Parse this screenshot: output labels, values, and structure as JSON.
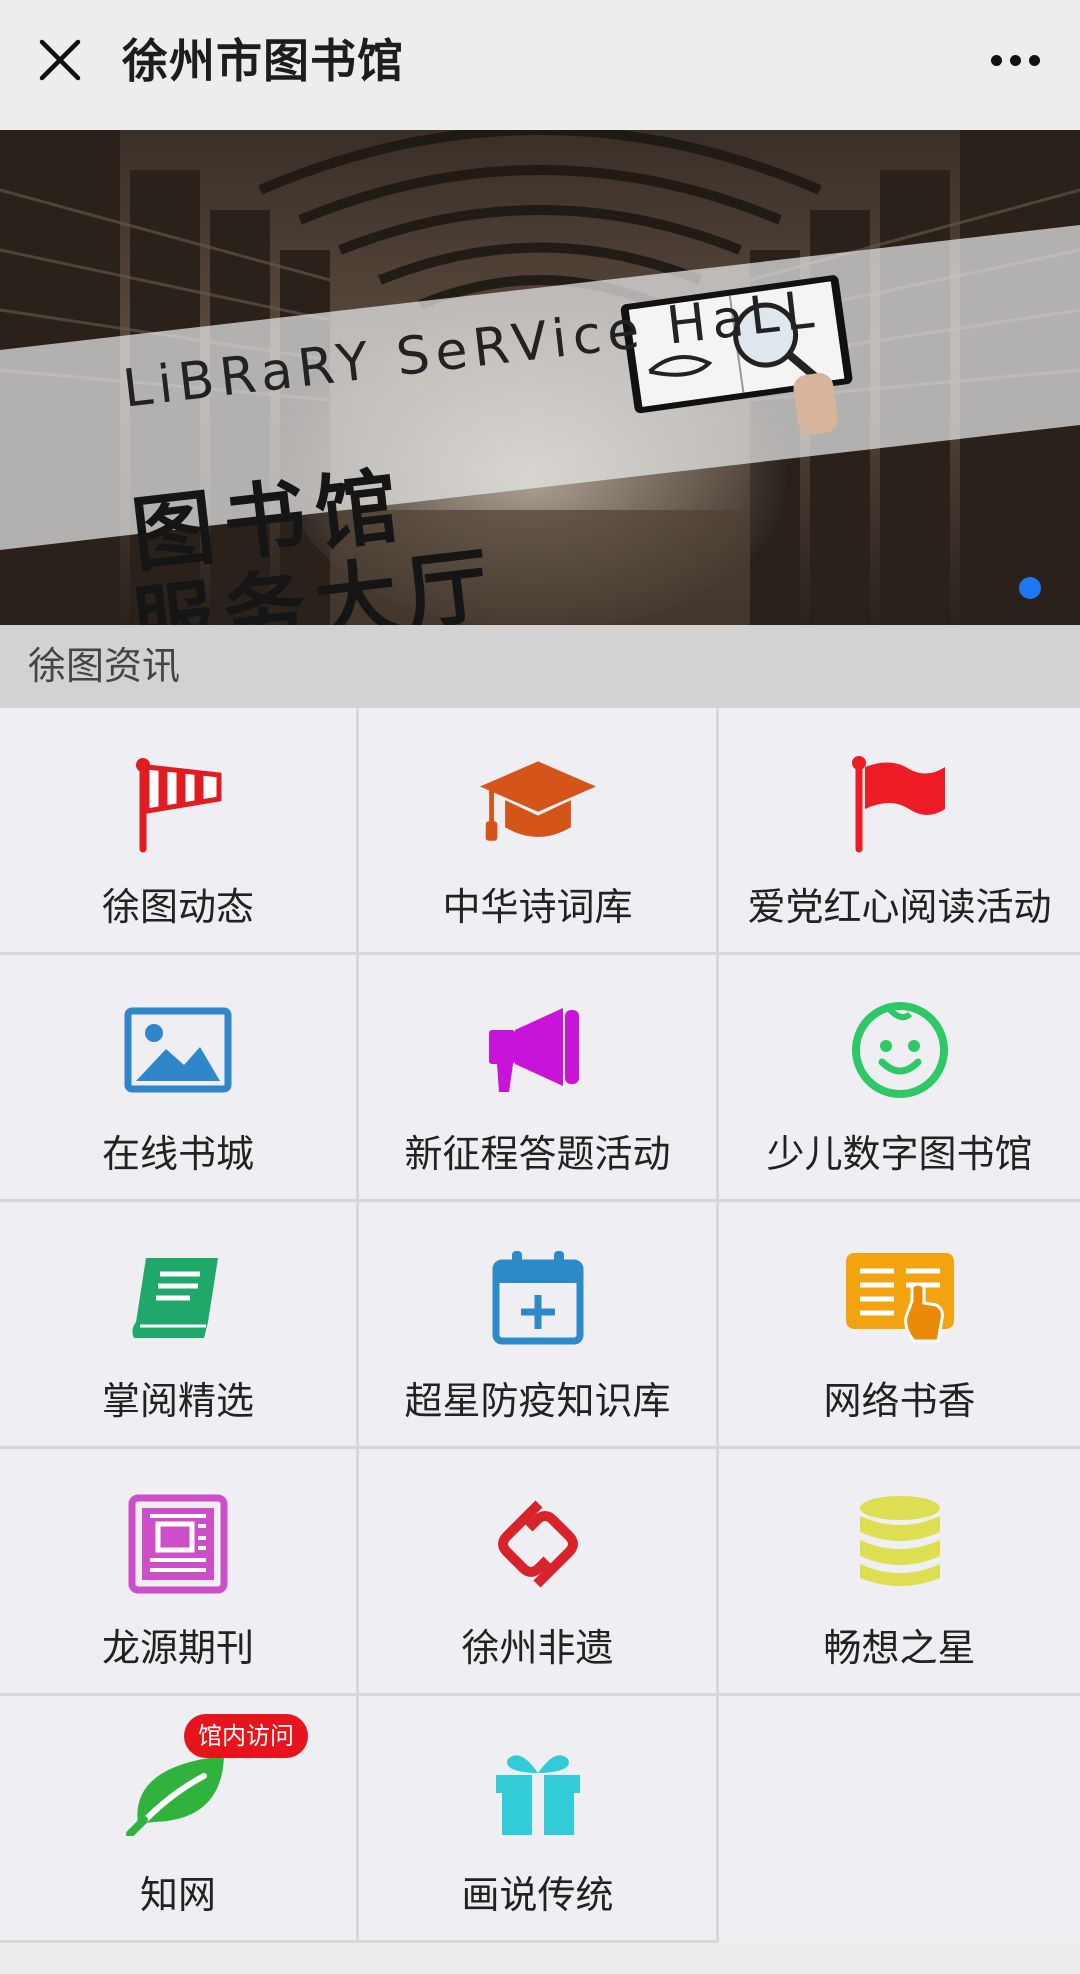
{
  "window": {
    "title": "徐州市图书馆",
    "close_icon": "close-icon",
    "more_icon": "more-icon"
  },
  "banner": {
    "title_en": "LiBRaRY SeRVice HaLL",
    "title_cn_line1": "图书馆",
    "title_cn_line2": "服务大厅",
    "active_slide_indicator_color": "#1a78f2",
    "slides_count": 1
  },
  "section": {
    "title": "徐图资讯"
  },
  "grid": {
    "items": [
      {
        "label": "徐图动态",
        "icon": "windsock-icon",
        "color": "#e01b22"
      },
      {
        "label": "中华诗词库",
        "icon": "graduation-cap-icon",
        "color": "#d5541a"
      },
      {
        "label": "爱党红心阅读活动",
        "icon": "flag-icon",
        "color": "#ee1c25"
      },
      {
        "label": "在线书城",
        "icon": "image-icon",
        "color": "#2f86c8"
      },
      {
        "label": "新征程答题活动",
        "icon": "megaphone-icon",
        "color": "#c813d9"
      },
      {
        "label": "少儿数字图书馆",
        "icon": "baby-face-icon",
        "color": "#2ec866"
      },
      {
        "label": "掌阅精选",
        "icon": "book-icon",
        "color": "#1fa86a"
      },
      {
        "label": "超星防疫知识库",
        "icon": "calendar-plus-icon",
        "color": "#2c8ac9"
      },
      {
        "label": "网络书香",
        "icon": "reading-document-icon",
        "color": "#f2a30f"
      },
      {
        "label": "龙源期刊",
        "icon": "newspaper-icon",
        "color": "#cc4fc8"
      },
      {
        "label": "徐州非遗",
        "icon": "chain-link-icon",
        "color": "#d9232b"
      },
      {
        "label": "畅想之星",
        "icon": "database-icon",
        "color": "#dede52"
      },
      {
        "label": "知网",
        "icon": "leaf-icon",
        "color": "#2fb33d",
        "badge": "馆内访问"
      },
      {
        "label": "画说传统",
        "icon": "gift-icon",
        "color": "#32ccd9"
      }
    ]
  }
}
